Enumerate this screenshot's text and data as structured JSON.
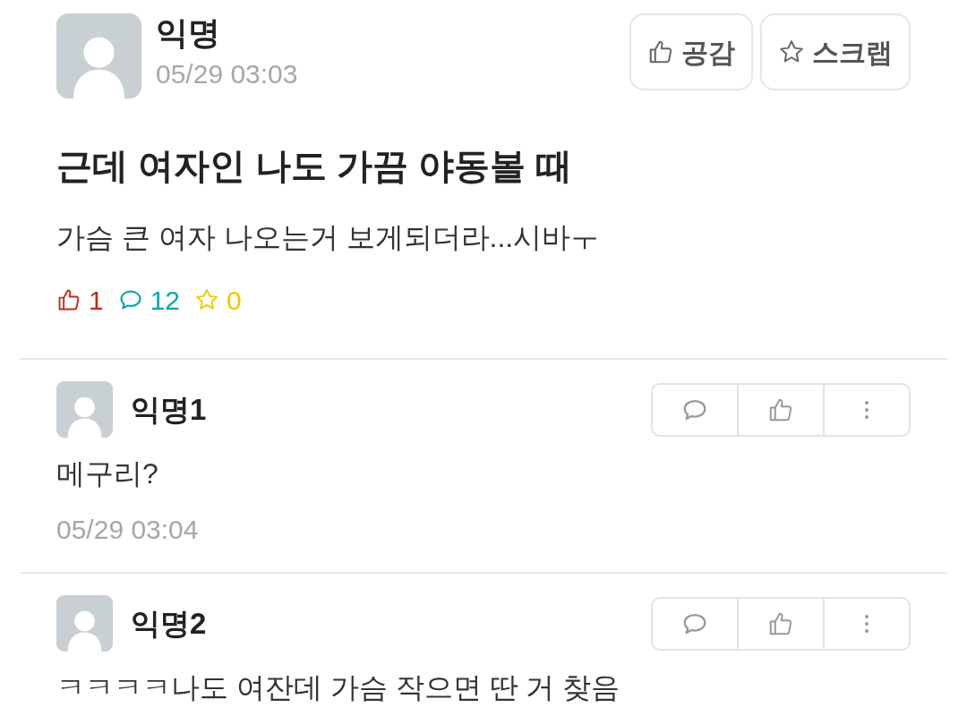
{
  "post": {
    "author": "익명",
    "time": "05/29 03:03",
    "buttons": [
      {
        "label": "공감",
        "kind": "like"
      },
      {
        "label": "스크랩",
        "kind": "scrap"
      }
    ],
    "title": "근데 여자인 나도 가끔 야동볼 때",
    "body": "가슴 큰 여자 나오는거 보게되더라...시바ㅜ",
    "stats": [
      {
        "kind": "like",
        "value": "1",
        "color": "#c62917"
      },
      {
        "kind": "comment",
        "value": "12",
        "color": "#0ca5af"
      },
      {
        "kind": "scrap",
        "value": "0",
        "color": "#f5c400"
      }
    ]
  },
  "comments": [
    {
      "author": "익명1",
      "text": "메구리?",
      "time": "05/29 03:04"
    },
    {
      "author": "익명2",
      "text": "ㅋㅋㅋㅋ나도 여잔데 가슴 작으면 딴 거 찾음"
    }
  ]
}
